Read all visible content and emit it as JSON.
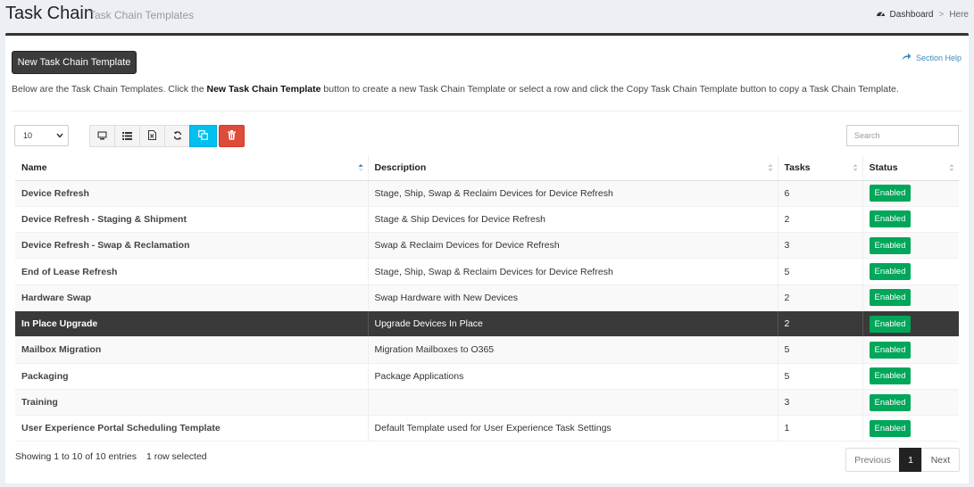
{
  "header": {
    "title": "Task Chain",
    "subtitle": "Task Chain Templates",
    "breadcrumb": {
      "dashboard": "Dashboard",
      "separator": ">",
      "current": "Here",
      "icon": "dashboard-icon"
    }
  },
  "toolbar": {
    "new_button": "New Task Chain Template",
    "section_help": "Section Help",
    "description_before": "Below are the Task Chain Templates. Click the ",
    "description_bold": "New Task Chain Template",
    "description_after": " button to create a new Task Chain Template or select a row and click the Copy Task Chain Template button to copy a Task Chain Template.",
    "page_length": "10",
    "search_placeholder": "Search",
    "tool_icons": [
      "monitor-icon",
      "list-icon",
      "export-file-icon",
      "refresh-icon",
      "copy-icon",
      "trash-icon"
    ],
    "accent_cyan": "#00c0ef",
    "accent_red": "#dd4b39"
  },
  "table": {
    "columns": [
      "Name",
      "Description",
      "Tasks",
      "Status"
    ],
    "rows": [
      {
        "name": "Device Refresh",
        "description": "Stage, Ship, Swap & Reclaim Devices for Device Refresh",
        "tasks": "6",
        "status": "Enabled"
      },
      {
        "name": "Device Refresh - Staging & Shipment",
        "description": "Stage & Ship Devices for Device Refresh",
        "tasks": "2",
        "status": "Enabled"
      },
      {
        "name": "Device Refresh - Swap & Reclamation",
        "description": "Swap & Reclaim Devices for Device Refresh",
        "tasks": "3",
        "status": "Enabled"
      },
      {
        "name": "End of Lease Refresh",
        "description": "Stage, Ship, Swap & Reclaim Devices for Device Refresh",
        "tasks": "5",
        "status": "Enabled"
      },
      {
        "name": "Hardware Swap",
        "description": "Swap Hardware with New Devices",
        "tasks": "2",
        "status": "Enabled"
      },
      {
        "name": "In Place Upgrade",
        "description": "Upgrade Devices In Place",
        "tasks": "2",
        "status": "Enabled"
      },
      {
        "name": "Mailbox Migration",
        "description": "Migration Mailboxes to O365",
        "tasks": "5",
        "status": "Enabled"
      },
      {
        "name": "Packaging",
        "description": "Package Applications",
        "tasks": "5",
        "status": "Enabled"
      },
      {
        "name": "Training",
        "description": "",
        "tasks": "3",
        "status": "Enabled"
      },
      {
        "name": "User Experience Portal Scheduling Template",
        "description": "Default Template used for User Experience Task Settings",
        "tasks": "1",
        "status": "Enabled"
      }
    ],
    "selected_row": 5,
    "status_color": "#00a65a"
  },
  "footer": {
    "info": "Showing 1 to 10 of 10 entries",
    "selection": "1 row selected",
    "pagination": {
      "previous": "Previous",
      "current": "1",
      "next": "Next"
    }
  }
}
